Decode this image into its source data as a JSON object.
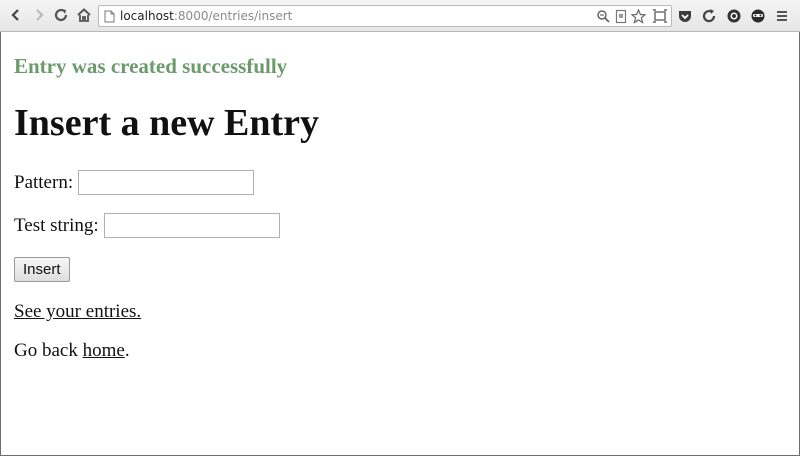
{
  "browser": {
    "url_host": "localhost",
    "url_path": ":8000/entries/insert",
    "icons": [
      "back-icon",
      "forward-icon",
      "reload-icon",
      "home-icon",
      "page-icon",
      "zoom-icon",
      "reader-icon",
      "bookmark-star-icon",
      "window-icon",
      "pocket-icon",
      "refresh-ext-icon",
      "opera-icon",
      "mask-icon",
      "menu-icon"
    ]
  },
  "page": {
    "flash_message": "Entry was created successfully",
    "heading": "Insert a new Entry",
    "form": {
      "pattern_label": "Pattern:",
      "pattern_value": "",
      "test_label": "Test string:",
      "test_value": "",
      "submit_label": "Insert"
    },
    "entries_link": "See your entries.",
    "go_back_prefix": "Go back ",
    "home_link": "home",
    "go_back_suffix": "."
  },
  "colors": {
    "flash_green": "#6b9a6b",
    "text": "#111111"
  }
}
